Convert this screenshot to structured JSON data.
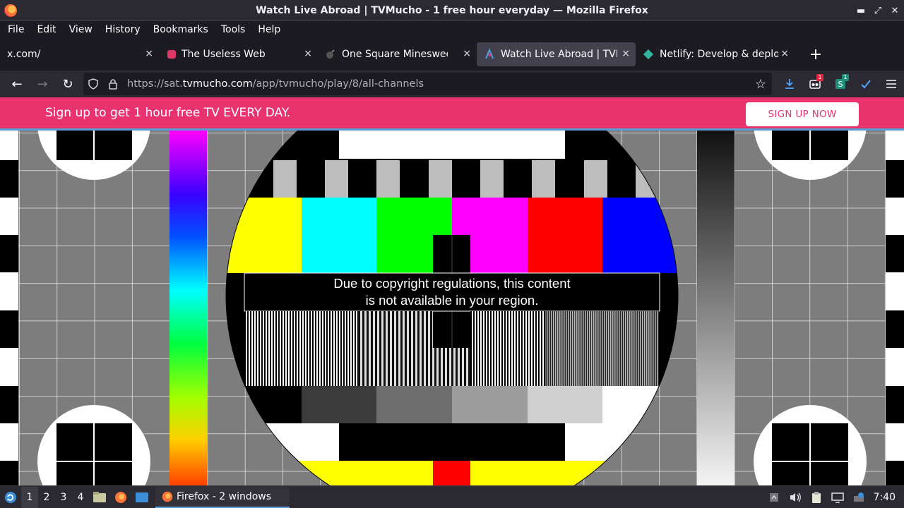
{
  "window": {
    "title": "Watch Live Abroad | TVMucho - 1 free hour everyday — Mozilla Firefox",
    "minimize": "▬",
    "maximize": "⤢",
    "close": "✕"
  },
  "menu": [
    "File",
    "Edit",
    "View",
    "History",
    "Bookmarks",
    "Tools",
    "Help"
  ],
  "tabs": [
    {
      "label": "x.com/",
      "favicon": "none",
      "active": false
    },
    {
      "label": "The Useless Web",
      "favicon": "#e03868",
      "active": false
    },
    {
      "label": "One Square Minesweeper",
      "favicon": "#444444",
      "active": false
    },
    {
      "label": "Watch Live Abroad | TVMucho",
      "favicon": "#4aa3df",
      "active": true
    },
    {
      "label": "Netlify: Develop & deploy",
      "favicon": "#32b5a0",
      "active": false
    }
  ],
  "tab_close": "×",
  "new_tab": "+",
  "nav": {
    "back": "←",
    "forward": "→",
    "reload": "↻",
    "url_prefix": "https://sat.",
    "url_domain": "tvmucho.com",
    "url_path": "/app/tvmucho/play/8/all-channels",
    "bookmark_star": "☆",
    "badges": {
      "ublock": "1",
      "ext": "1"
    }
  },
  "promo": {
    "text": "Sign up to get 1 hour free TV EVERY DAY.",
    "cta": "SIGN UP NOW"
  },
  "player": {
    "message_line1": "Due to copyright regulations, this content",
    "message_line2": "is not available in your region."
  },
  "taskbar": {
    "workspaces": [
      "1",
      "2",
      "3",
      "4"
    ],
    "active_workspace": "1",
    "window_label": "Firefox - 2 windows",
    "clock": "7:40"
  },
  "colors": {
    "accent": "#e8336f",
    "chrome_dark": "#1c1b22",
    "chrome": "#2b2a33"
  }
}
